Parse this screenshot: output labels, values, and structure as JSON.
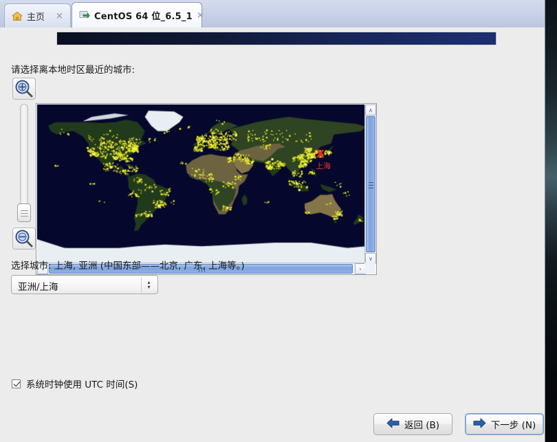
{
  "window": {
    "tabs": [
      {
        "id": "home",
        "label": "主页",
        "icon": "home-icon",
        "active": false,
        "closable": true
      },
      {
        "id": "vm",
        "label": "CentOS 64 位_6.5_1",
        "icon": "virtual-machine-icon",
        "active": true,
        "closable": true
      }
    ],
    "close_glyph": "×"
  },
  "installer": {
    "banner_color": "#18275c",
    "prompt": "请选择离本地时区最近的城市:",
    "zoom_controls": {
      "zoom_in_label": "放大",
      "zoom_out_label": "缩小",
      "slider_value": 0
    },
    "map": {
      "selected_city_marker": "X",
      "selected_city_label": "上海",
      "marker_color": "#ff2020",
      "label_color": "#f33030",
      "ocean_color": "#05082c",
      "city_dot_color": "#e8e82c"
    },
    "scrollbars": {
      "up_glyph": "∧",
      "down_glyph": "∨",
      "left_glyph": "‹",
      "right_glyph": "›",
      "thumb_color": "#7ea3dd"
    },
    "selection_line": "选择城市: 上海, 亚洲 (中国东部——北京, 广东, 上海等。)",
    "timezone_combo": {
      "value": "亚洲/上海",
      "up_glyph": "▴",
      "down_glyph": "▾",
      "options": [
        "亚洲/上海"
      ]
    },
    "utc_checkbox": {
      "label": "系统时钟使用 UTC 时间(S)",
      "checked": true
    },
    "footer": {
      "back_label": "返回 (B)",
      "next_label": "下一步 (N)",
      "arrow_color": "#2a5fad"
    }
  }
}
